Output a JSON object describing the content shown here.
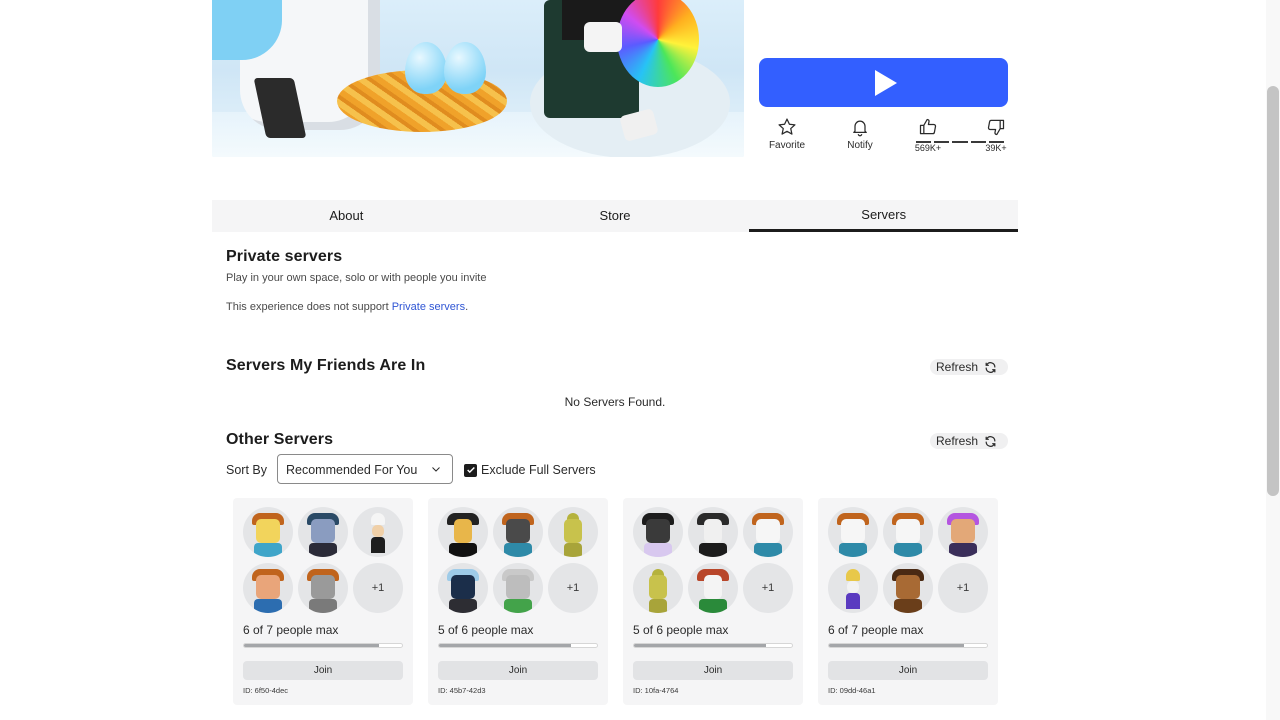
{
  "actions": {
    "favorite_label": "Favorite",
    "notify_label": "Notify",
    "upvotes": "569K+",
    "downvotes": "39K+"
  },
  "tabs": [
    {
      "label": "About",
      "active": false
    },
    {
      "label": "Store",
      "active": false
    },
    {
      "label": "Servers",
      "active": true
    }
  ],
  "private_servers": {
    "title": "Private servers",
    "subtitle": "Play in your own space, solo or with people you invite",
    "notice_prefix": "This experience does not support ",
    "notice_link": "Private servers",
    "notice_suffix": "."
  },
  "friends_servers": {
    "title": "Servers My Friends Are In",
    "refresh_label": "Refresh",
    "empty_text": "No Servers Found."
  },
  "other_servers": {
    "title": "Other Servers",
    "refresh_label": "Refresh",
    "sort_label": "Sort By",
    "sort_value": "Recommended For You",
    "exclude_full_label": "Exclude Full Servers",
    "exclude_full_checked": true,
    "join_label": "Join",
    "more_players": "+1",
    "servers": [
      {
        "capacity": "6 of 7 people max",
        "fill": 0.857,
        "id": "ID: 6f50-4dec"
      },
      {
        "capacity": "5 of 6 people max",
        "fill": 0.833,
        "id": "ID: 45b7-42d3"
      },
      {
        "capacity": "5 of 6 people max",
        "fill": 0.833,
        "id": "ID: 10fa-4764"
      },
      {
        "capacity": "6 of 7 people max",
        "fill": 0.857,
        "id": "ID: 09dd-46a1"
      }
    ]
  },
  "colors": {
    "play_button": "#335fff",
    "link": "#2f55d4",
    "tab_active_border": "#1c1c1c",
    "card_bg": "#f5f5f6"
  }
}
